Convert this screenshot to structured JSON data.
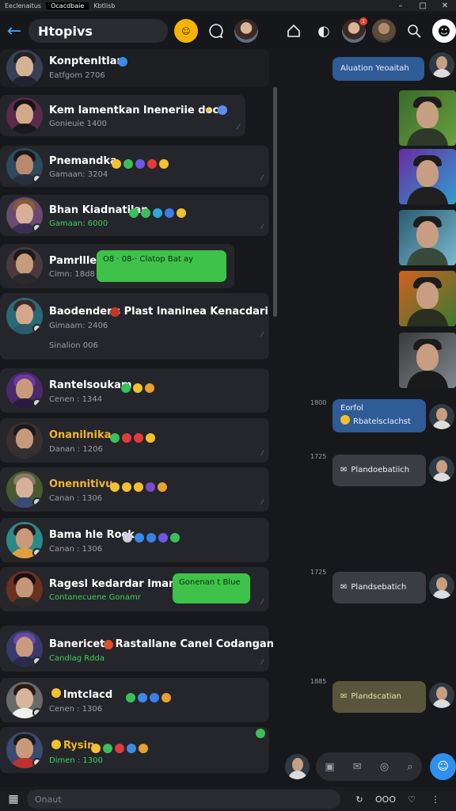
{
  "os": {
    "tabs": [
      {
        "label": "Eeclenaitus",
        "active": false
      },
      {
        "label": "Ocacdbaie",
        "active": true
      },
      {
        "label": "Kbtlisb",
        "active": false
      }
    ],
    "controls": [
      "–",
      "□",
      "✕"
    ]
  },
  "header": {
    "back_icon": "arrow-left-icon",
    "title": "Htopivs",
    "notification_badge": "1"
  },
  "chats": [
    {
      "name": "Konptenltlan",
      "sub": "Eatfgom 2706",
      "sub_color": "gray"
    },
    {
      "name": "Kem lamentkan lneneriie doca",
      "sub": "Gonieuie 1400",
      "sub_color": "gray"
    },
    {
      "name": "Pnemandka",
      "sub": "Gamaan: 3204",
      "sub_color": "gray"
    },
    {
      "name": "Bhan Kiadnatilan",
      "sub": "Gamaan: 6000",
      "sub_color": "green"
    },
    {
      "name": "Pamrlller",
      "sub": "Cimn: 18d8",
      "sub_color": "gray",
      "bubble": "O8 · 08-· Clatop Bat ay"
    },
    {
      "name": "Baodendens Plast lnaninea Kenacdari",
      "sub": "Gimaam: 2406",
      "sub2": "Sinalion 006",
      "sub_color": "gray"
    },
    {
      "name": "Rantelsoukam",
      "sub": "Cenen : 1344",
      "sub_color": "gray"
    },
    {
      "name": "Onanilnika",
      "sub": "Danan : 1206",
      "sub_color": "gray",
      "name_color": "orange"
    },
    {
      "name": "Onennitivu",
      "sub": "Canan : 1306",
      "sub_color": "gray",
      "name_color": "orange"
    },
    {
      "name": "Bama hle Rock",
      "sub": "Canan : 1306",
      "sub_color": "gray"
    },
    {
      "name": "Ragesl kedardar lman",
      "sub": "Contanecuene Gonamr",
      "sub_color": "green",
      "bubble": "Gonenan t Blue"
    },
    {
      "name": "Banericeta Rastallane Canel Codangan",
      "sub": "Candlag Rdda",
      "sub_color": "green"
    },
    {
      "name": "lmtclacd",
      "sub": "Cenen : 1306",
      "sub_color": "gray"
    },
    {
      "name": "Rysin",
      "sub": "Dimen : 1300",
      "sub_color": "green"
    }
  ],
  "conversation": {
    "top_bubble": "Aluation Yeoaitah",
    "msg1_time": "1800",
    "msg1_line1": "Eorfol",
    "msg1_line2": "Rbatelsclachst",
    "msg2_time": "1725",
    "msg2": "Plandoebatiich",
    "msg3_time": "1725",
    "msg3": "Plandsebatich",
    "msg4_time": "1885",
    "msg4": "Plandscatian"
  },
  "bottom": {
    "input_placeholder": "Onaut",
    "right_label": "OOO"
  },
  "colors": {
    "accent_blue": "#2f8ff0",
    "green_bubble": "#3ec24a",
    "bg": "#17181b"
  }
}
